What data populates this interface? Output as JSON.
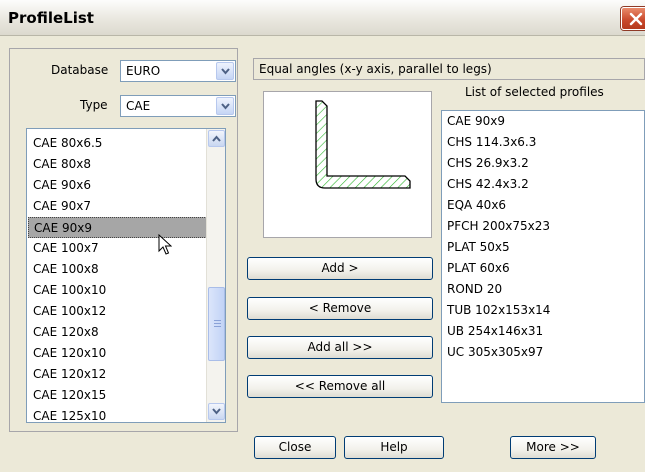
{
  "window": {
    "title": "ProfileList"
  },
  "database": {
    "label": "Database",
    "value": "EURO"
  },
  "type": {
    "label": "Type",
    "value": "CAE"
  },
  "profile_list": {
    "items": [
      "CAE 80x6.5",
      "CAE 80x8",
      "CAE 90x6",
      "CAE 90x7",
      "CAE 90x9",
      "CAE 100x7",
      "CAE 100x8",
      "CAE 100x10",
      "CAE 100x12",
      "CAE 120x8",
      "CAE 120x10",
      "CAE 120x12",
      "CAE 120x15",
      "CAE 125x10"
    ],
    "selected": "CAE 90x9"
  },
  "description": "Equal angles (x-y axis, parallel to legs)",
  "selected_profiles": {
    "title": "List of selected profiles",
    "items": [
      "CAE 90x9",
      "CHS 114.3x6.3",
      "CHS 26.9x3.2",
      "CHS 42.4x3.2",
      "EQA 40x6",
      "PFCH 200x75x23",
      "PLAT 50x5",
      "PLAT 60x6",
      "ROND 20",
      "TUB 102x153x14",
      "UB 254x146x31",
      "UC 305x305x97"
    ]
  },
  "buttons": {
    "add": "Add >",
    "remove": "< Remove",
    "add_all": "Add all >>",
    "remove_all": "<< Remove all",
    "close": "Close",
    "help": "Help",
    "more": "More >>"
  },
  "colors": {
    "selection": "#a6a6a6",
    "profile_hatch": "#2fb52f",
    "close_button": "#c8472a"
  }
}
